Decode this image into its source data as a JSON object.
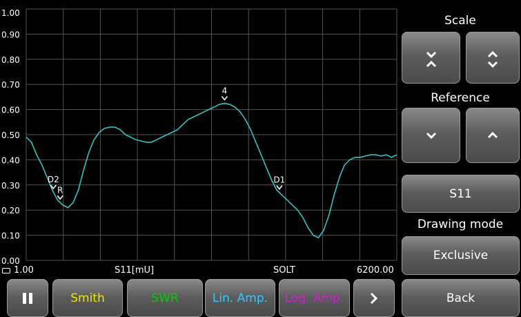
{
  "chart_data": {
    "type": "line",
    "xlim": [
      1.0,
      6200.0
    ],
    "ylim": [
      0.0,
      1.0
    ],
    "yticks": [
      "1.00",
      "0.90",
      "0.80",
      "0.70",
      "0.60",
      "0.50",
      "0.40",
      "0.30",
      "0.20",
      "0.10",
      "0.00"
    ],
    "grid": true,
    "line_color": "#33c3c3",
    "series_label": "S11[mU]",
    "points_y": [
      0.49,
      0.47,
      0.42,
      0.38,
      0.33,
      0.28,
      0.24,
      0.22,
      0.21,
      0.23,
      0.28,
      0.36,
      0.43,
      0.48,
      0.51,
      0.525,
      0.53,
      0.53,
      0.52,
      0.5,
      0.49,
      0.48,
      0.475,
      0.47,
      0.47,
      0.48,
      0.49,
      0.5,
      0.51,
      0.52,
      0.54,
      0.56,
      0.57,
      0.58,
      0.59,
      0.6,
      0.61,
      0.62,
      0.625,
      0.62,
      0.61,
      0.59,
      0.56,
      0.52,
      0.47,
      0.42,
      0.37,
      0.32,
      0.28,
      0.26,
      0.24,
      0.22,
      0.2,
      0.17,
      0.13,
      0.1,
      0.09,
      0.12,
      0.18,
      0.26,
      0.33,
      0.38,
      0.4,
      0.41,
      0.41,
      0.415,
      0.42,
      0.42,
      0.415,
      0.42,
      0.41,
      0.42
    ],
    "markers": [
      {
        "label": "D2",
        "index": 5.2
      },
      {
        "label": "R",
        "index": 6.5
      },
      {
        "label": "4",
        "index": 38
      },
      {
        "label": "D1",
        "index": 48.5
      }
    ]
  },
  "info": {
    "start": "1.00",
    "param": "S11[mU]",
    "cal": "SOLT",
    "stop": "6200.00"
  },
  "side": {
    "scale_label": "Scale",
    "reference_label": "Reference",
    "s11_label": "S11",
    "drawing_mode_label": "Drawing mode",
    "exclusive_label": "Exclusive",
    "back_label": "Back"
  },
  "bottom": {
    "smith": "Smith",
    "swr": "SWR",
    "lin_amp": "Lin. Amp.",
    "log_amp": "Log. Amp."
  },
  "colors": {
    "smith": "#e8e800",
    "swr": "#00d000",
    "lin_amp": "#30c8ff",
    "log_amp": "#d020d0"
  }
}
